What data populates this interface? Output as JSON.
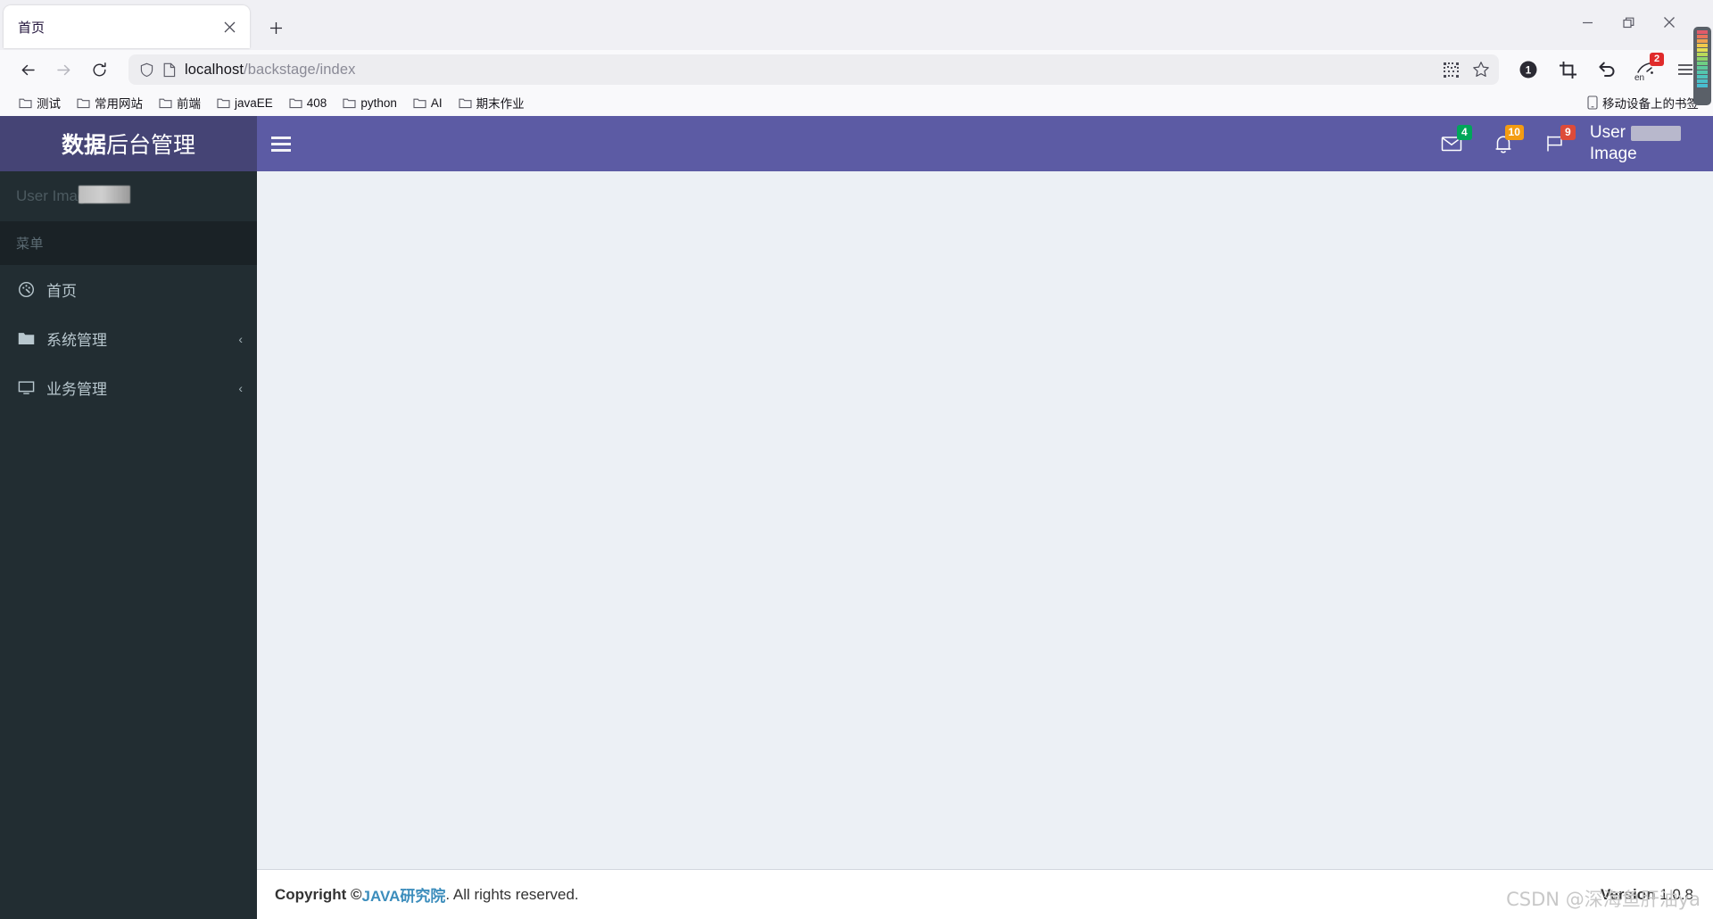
{
  "browser": {
    "tab": {
      "title": "首页",
      "close_icon": "close-icon"
    },
    "newtab_label": "+",
    "window_controls": {
      "minimize": "minimize-icon",
      "restore": "restore-icon",
      "close": "close-icon"
    },
    "nav": {
      "back": "back-arrow-icon",
      "forward": "forward-arrow-icon",
      "reload": "reload-icon"
    },
    "url": {
      "host": "localhost",
      "path": "/backstage/index",
      "shield_icon": "shield-icon",
      "page_icon": "page-icon"
    },
    "url_right": {
      "qr_icon": "qr-code-icon",
      "bookmark_icon": "star-icon"
    },
    "toolbar": [
      {
        "name": "account-badge-icon",
        "label": "1"
      },
      {
        "name": "crop-tool-icon",
        "label": ""
      },
      {
        "name": "undo-icon",
        "label": ""
      },
      {
        "name": "extension-en-icon",
        "label": "en",
        "badge": "2"
      },
      {
        "name": "app-menu-icon",
        "label": ""
      }
    ],
    "bookmarks": [
      {
        "label": "测试"
      },
      {
        "label": "常用网站"
      },
      {
        "label": "前端"
      },
      {
        "label": "javaEE"
      },
      {
        "label": "408"
      },
      {
        "label": "python"
      },
      {
        "label": "AI"
      },
      {
        "label": "期末作业"
      }
    ],
    "mobile_bookmarks": "移动设备上的书签"
  },
  "app": {
    "logo": {
      "bold": "数据",
      "rest": "后台管理"
    },
    "sidebar_toggle": "hamburger-icon",
    "topnav_icons": [
      {
        "name": "messages-icon",
        "badge": "4",
        "badge_color": "#00a65a"
      },
      {
        "name": "notifications-icon",
        "badge": "10",
        "badge_color": "#f39c12"
      },
      {
        "name": "tasks-flag-icon",
        "badge": "9",
        "badge_color": "#dd4b39"
      }
    ],
    "user": {
      "line1": "User",
      "line2": "Image"
    },
    "sidebar": {
      "user_panel": "User Image",
      "menu_header": "菜单",
      "items": [
        {
          "label": "首页",
          "icon": "dashboard-icon",
          "chevron": ""
        },
        {
          "label": "系统管理",
          "icon": "folder-icon",
          "chevron": "‹"
        },
        {
          "label": "业务管理",
          "icon": "monitor-icon",
          "chevron": "‹"
        }
      ]
    },
    "footer": {
      "copyright_prefix": "Copyright © ",
      "link": "JAVA研究院",
      "copyright_suffix": ". All rights reserved.",
      "version_label": "Version",
      "version_number": "1.0.8"
    }
  },
  "watermark": "CSDN @深海鱼肝油ya",
  "colors": {
    "header_purple": "#5c5ba4",
    "logo_purple": "#454475",
    "sidebar_dark": "#222d32",
    "menu_header_dark": "#1a2226",
    "content_bg": "#ecf0f5",
    "link_blue": "#3c8dbc"
  }
}
